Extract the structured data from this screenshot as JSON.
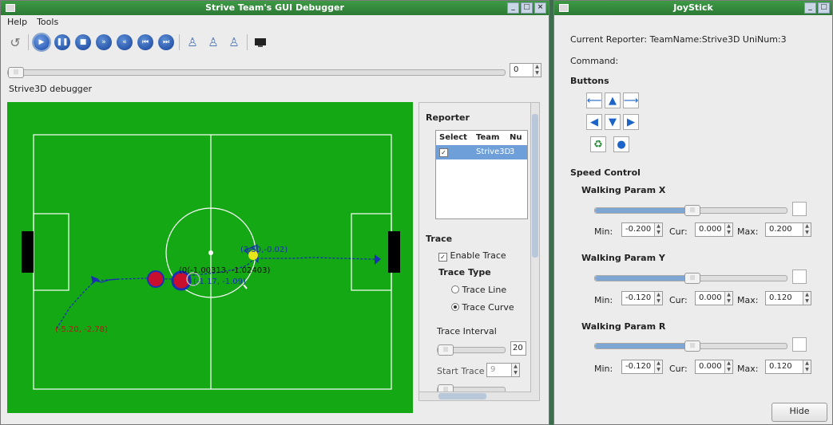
{
  "main": {
    "title": "Strive Team's GUI Debugger",
    "menu": [
      "Help",
      "Tools"
    ],
    "frame_value": "0",
    "debugger_label": "Strive3D debugger",
    "reporter": {
      "heading": "Reporter",
      "columns": [
        "Select",
        "Team",
        "Nu"
      ],
      "row": {
        "team": "Strive3D",
        "num": "3"
      }
    },
    "trace": {
      "heading": "Trace",
      "enable_label": "Enable Trace",
      "type_heading": "Trace Type",
      "line_label": "Trace Line",
      "curve_label": "Trace Curve",
      "interval_label": "Trace Interval",
      "interval_value": "20",
      "start_label": "Start Trace",
      "start_value": "9"
    },
    "field": {
      "labels": [
        "(3.50,-0.02)",
        "(0(-1.00313, -1.02403)",
        "(-1.17, -1.09)",
        "(-5.20, -2.78)"
      ]
    }
  },
  "joy": {
    "title": "JoyStick",
    "reporter_text": "Current Reporter: TeamName:Strive3D  UniNum:3",
    "command_label": "Command:",
    "buttons_heading": "Buttons",
    "speed_heading": "Speed Control",
    "params": [
      {
        "name": "Walking Param X",
        "min": "-0.200",
        "cur": "0.000",
        "max": "0.200"
      },
      {
        "name": "Walking Param Y",
        "min": "-0.120",
        "cur": "0.000",
        "max": "0.120"
      },
      {
        "name": "Walking Param R",
        "min": "-0.120",
        "cur": "0.000",
        "max": "0.120"
      }
    ],
    "min_label": "Min:",
    "cur_label": "Cur:",
    "max_label": "Max:",
    "hide_label": "Hide"
  },
  "colors": {
    "title_green": "#2d7a35",
    "field_green": "#14a814",
    "selection": "#6f9fd8",
    "arrow_blue": "#1d64c8"
  }
}
